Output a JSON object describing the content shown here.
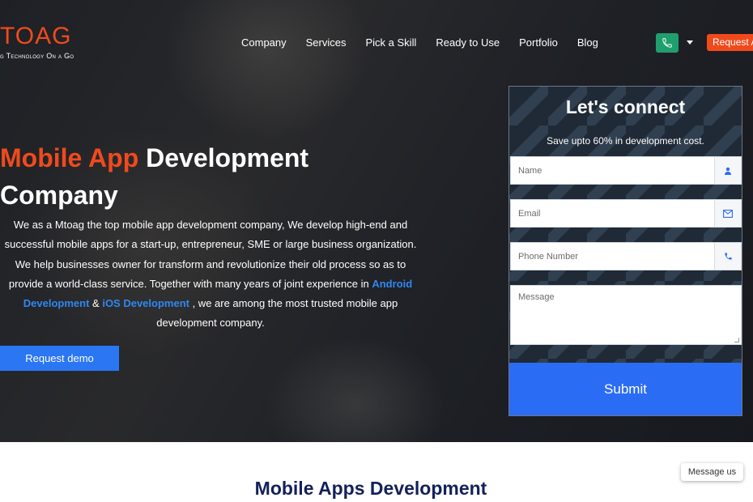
{
  "header": {
    "logo_word": "TOAG",
    "logo_tagline": "g Technology On a Go",
    "nav": [
      "Company",
      "Services",
      "Pick a Skill",
      "Ready to Use",
      "Portfolio",
      "Blog"
    ],
    "request_label": "Request A",
    "phone_icon": "phone-icon",
    "dropdown_icon": "chevron-down-icon"
  },
  "hero": {
    "headline_accent": "Mobile App",
    "headline_rest": " Development",
    "headline_line2": "Company",
    "desc_part1": "We as a Mtoag the top mobile app development company, We develop high-end and successful mobile apps for a start-up, entrepreneur, SME or large business organization. We help businesses owner for transform and revolutionize their old process so as to provide a world-class service. Together with many years of joint experience in ",
    "link_android": "Android Development",
    "desc_and": " & ",
    "link_ios": "iOS Development",
    "desc_part2": " , we are among the most trusted mobile app development company.",
    "demo_label": "Request demo"
  },
  "form": {
    "title": "Let's connect",
    "subtitle": "Save upto 60% in development cost.",
    "name_placeholder": "Name",
    "email_placeholder": "Email",
    "phone_placeholder": "Phone Number",
    "message_placeholder": "Message",
    "submit_label": "Submit"
  },
  "section": {
    "title": "Mobile Apps Development"
  },
  "chat": {
    "label": "Message us"
  },
  "colors": {
    "accent": "#f04a1c",
    "primary": "#2a76f3",
    "phone_green": "#1f9f6e",
    "heading_navy": "#13205a"
  }
}
